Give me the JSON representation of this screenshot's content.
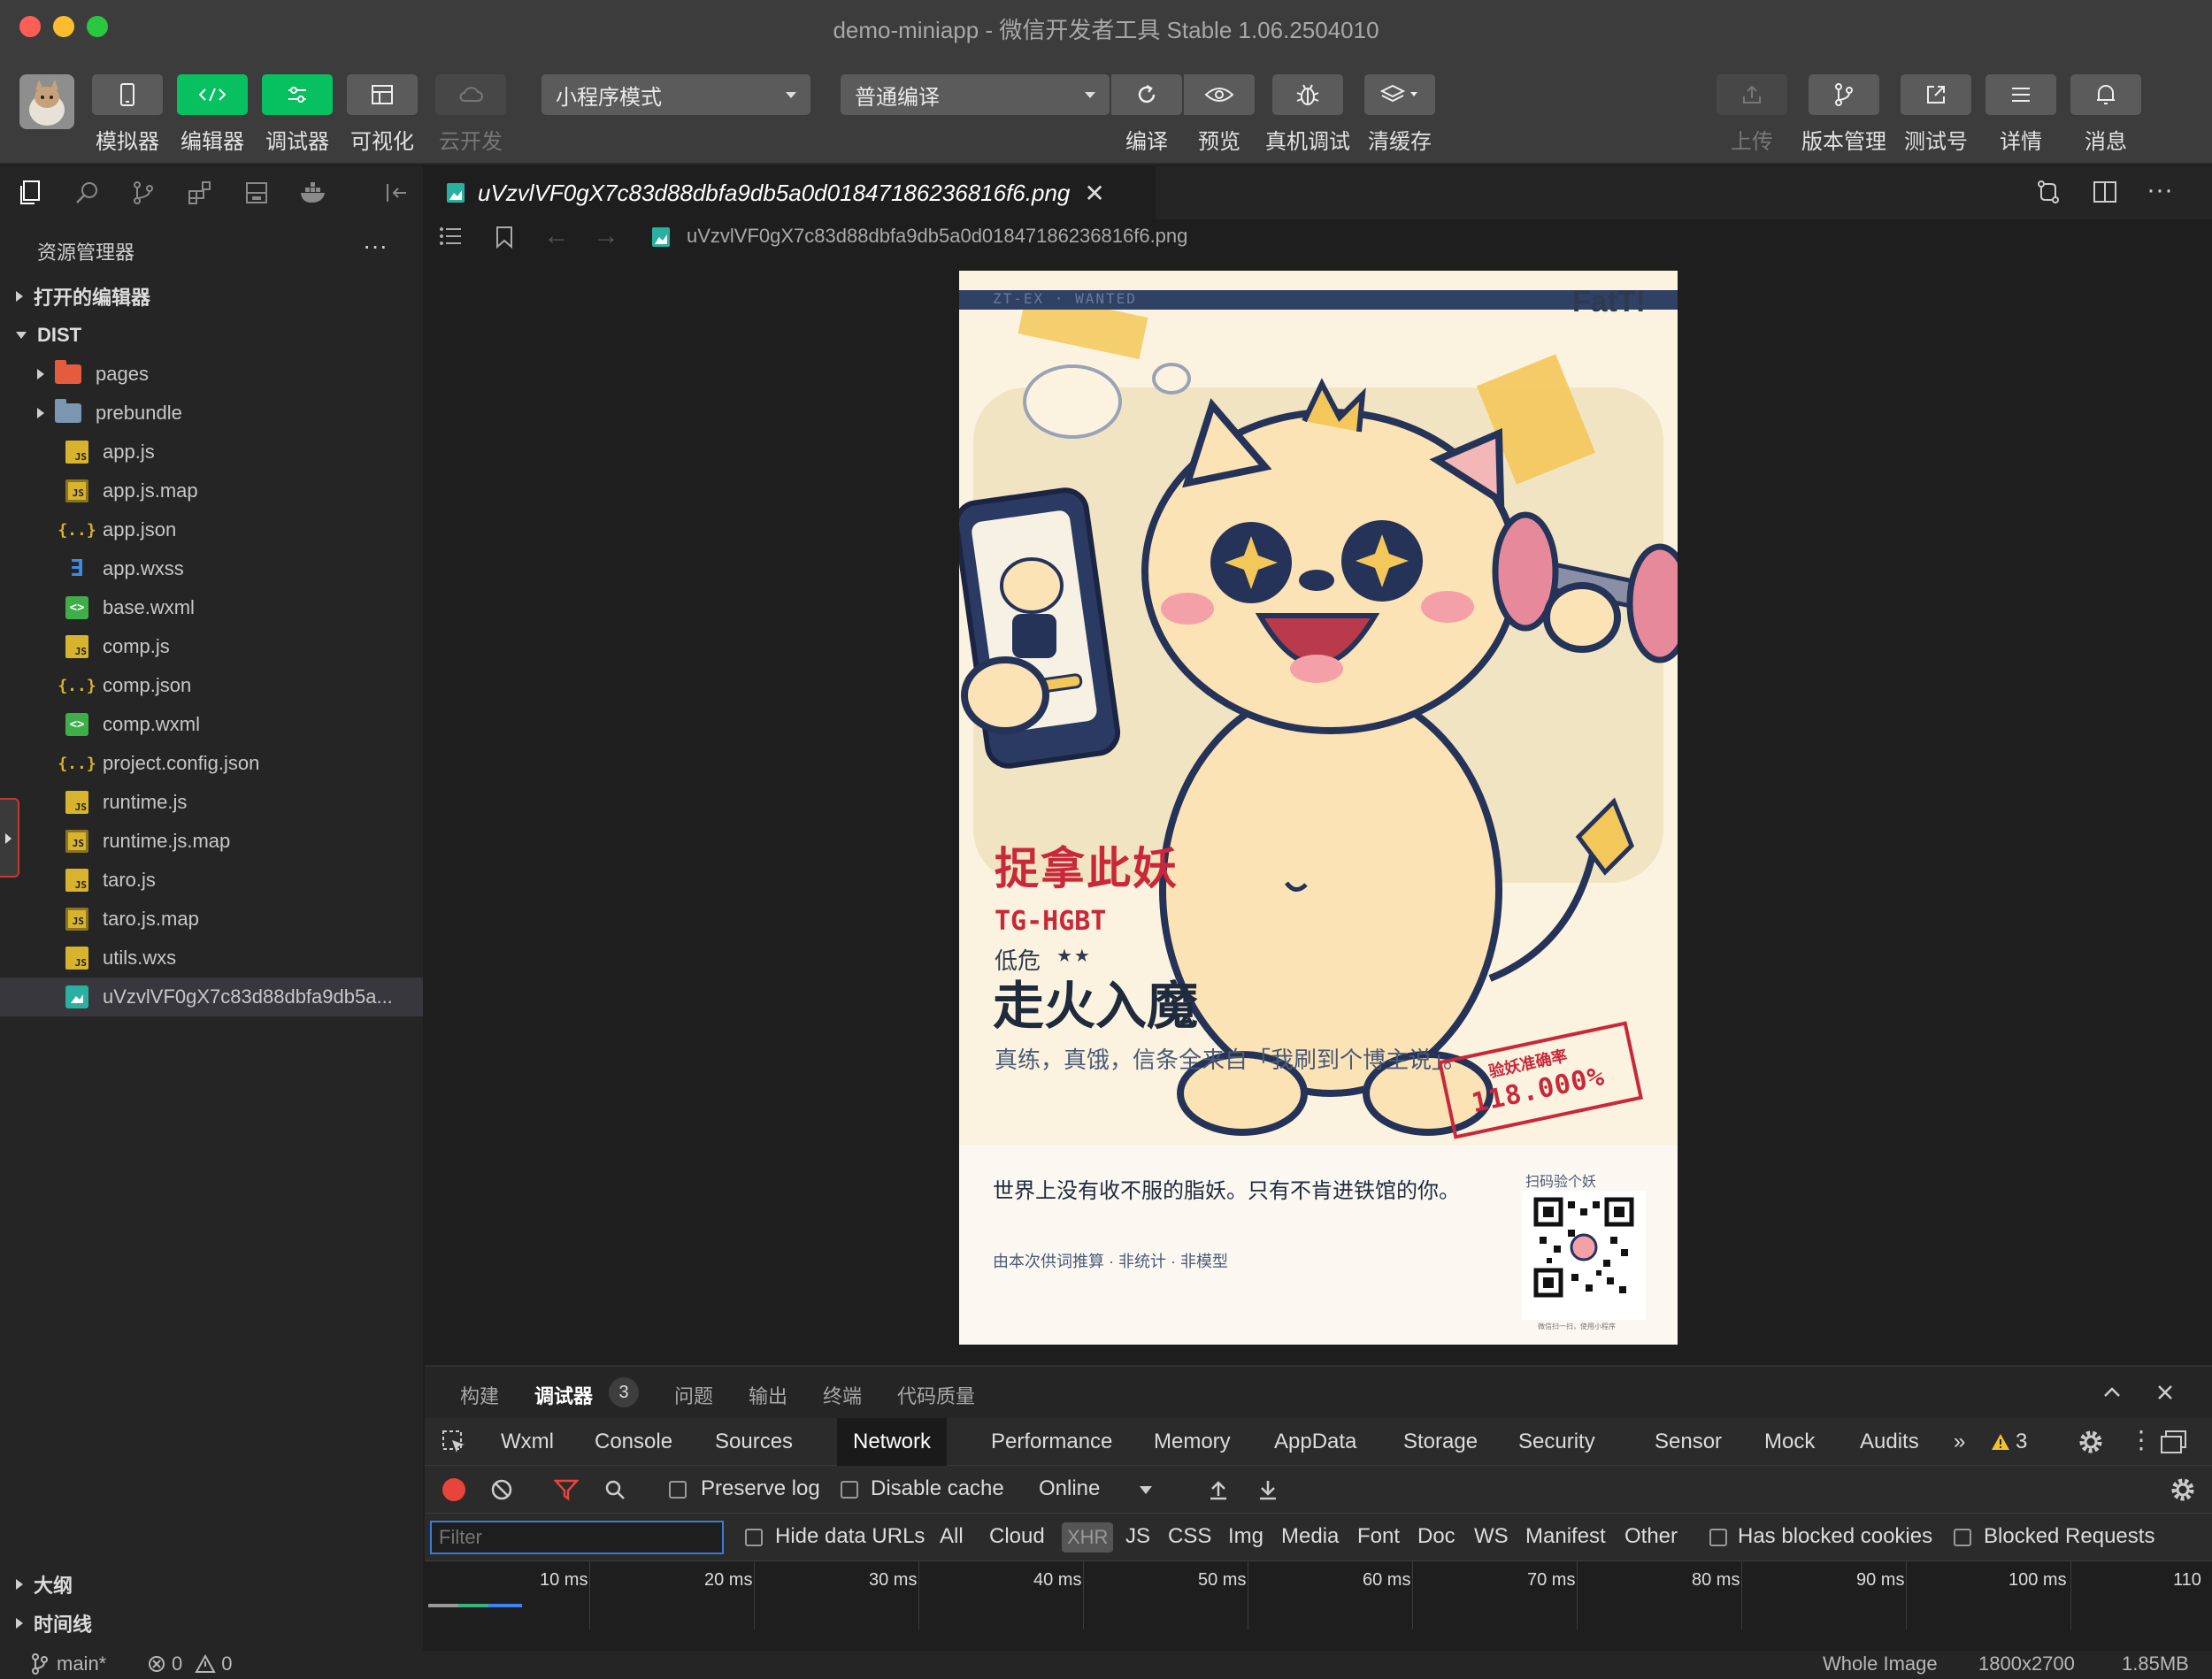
{
  "window": {
    "title": "demo-miniapp",
    "subtitle": "微信开发者工具 Stable 1.06.2504010",
    "traffic_colors": [
      "#ff5f57",
      "#febc2e",
      "#28c840"
    ]
  },
  "toolbar": {
    "left_buttons": [
      {
        "label": "模拟器",
        "icon": "phone-icon"
      },
      {
        "label": "编辑器",
        "icon": "code-icon"
      },
      {
        "label": "调试器",
        "icon": "sliders-icon"
      },
      {
        "label": "可视化",
        "icon": "layout-icon"
      },
      {
        "label": "云开发",
        "icon": "cloud-icon"
      }
    ],
    "mode_select": "小程序模式",
    "compile_select": "普通编译",
    "center_buttons": [
      {
        "label": "编译",
        "icon": "refresh-icon"
      },
      {
        "label": "预览",
        "icon": "eye-icon"
      },
      {
        "label": "真机调试",
        "icon": "bug-icon"
      },
      {
        "label": "清缓存",
        "icon": "layers-icon"
      }
    ],
    "right_buttons": [
      {
        "label": "上传",
        "icon": "upload-icon"
      },
      {
        "label": "版本管理",
        "icon": "branch-icon"
      },
      {
        "label": "测试号",
        "icon": "external-link-icon"
      },
      {
        "label": "详情",
        "icon": "menu-icon"
      },
      {
        "label": "消息",
        "icon": "bell-icon"
      }
    ],
    "accent": "#07c160"
  },
  "sidebar": {
    "title": "资源管理器",
    "more": "···",
    "sections": {
      "open_editors": "打开的编辑器",
      "dist": "DIST",
      "outline": "大纲",
      "timeline": "时间线"
    },
    "items": [
      {
        "name": "pages",
        "type": "folder-pages"
      },
      {
        "name": "prebundle",
        "type": "folder"
      },
      {
        "name": "app.js",
        "type": "js"
      },
      {
        "name": "app.js.map",
        "type": "jsmap"
      },
      {
        "name": "app.json",
        "type": "json"
      },
      {
        "name": "app.wxss",
        "type": "wxss"
      },
      {
        "name": "base.wxml",
        "type": "wxml"
      },
      {
        "name": "comp.js",
        "type": "js"
      },
      {
        "name": "comp.json",
        "type": "json"
      },
      {
        "name": "comp.wxml",
        "type": "wxml"
      },
      {
        "name": "project.config.json",
        "type": "json"
      },
      {
        "name": "runtime.js",
        "type": "js"
      },
      {
        "name": "runtime.js.map",
        "type": "jsmap"
      },
      {
        "name": "taro.js",
        "type": "js"
      },
      {
        "name": "taro.js.map",
        "type": "jsmap"
      },
      {
        "name": "utils.wxs",
        "type": "js"
      },
      {
        "name": "uVzvlVF0gX7c83d88dbfa9db5a...",
        "type": "png",
        "selected": true
      }
    ]
  },
  "editor": {
    "tab_name": "uVzvlVF0gX7c83d88dbfa9db5a0d01847186236816f6.png",
    "breadcrumb": "uVzvlVF0gX7c83d88dbfa9db5a0d01847186236816f6.png"
  },
  "poster": {
    "header_left": "ZT-EX · WANTED",
    "brand": "FatT!",
    "title_red": "捉拿此妖",
    "code": "TG-HGBT",
    "level": "低危",
    "stars": "★★",
    "main": "走火入魔",
    "sub": "真练，真饿，信条全来自「我刷到个博主说」。",
    "stamp_label": "验妖准确率",
    "stamp_value": "118.000%",
    "slogan": "世界上没有收不服的脂妖。只有不肯进铁馆的你。",
    "note": "由本次供词推算 · 非统计 · 非模型",
    "qr_label": "扫码验个妖",
    "qr_caption": "微信扫一扫，使用小程序"
  },
  "panel": {
    "tabs": [
      "构建",
      "调试器",
      "问题",
      "输出",
      "终端",
      "代码质量"
    ],
    "active_tab": "调试器",
    "debugger_badge": "3"
  },
  "devtools": {
    "tabs": [
      "Wxml",
      "Console",
      "Sources",
      "Network",
      "Performance",
      "Memory",
      "AppData",
      "Storage",
      "Security",
      "Sensor",
      "Mock",
      "Audits"
    ],
    "active_tab": "Network",
    "overflow": "»",
    "warning_count": "3",
    "preserve_log": "Preserve log",
    "disable_cache": "Disable cache",
    "throttle": "Online",
    "filter_placeholder": "Filter",
    "hide_data_urls": "Hide data URLs",
    "types": [
      "All",
      "Cloud",
      "XHR",
      "JS",
      "CSS",
      "Img",
      "Media",
      "Font",
      "Doc",
      "WS",
      "Manifest",
      "Other"
    ],
    "has_blocked_cookies": "Has blocked cookies",
    "blocked_requests": "Blocked Requests",
    "ticks": [
      "10 ms",
      "20 ms",
      "30 ms",
      "40 ms",
      "50 ms",
      "60 ms",
      "70 ms",
      "80 ms",
      "90 ms",
      "100 ms",
      "110"
    ]
  },
  "statusbar": {
    "branch": "main*",
    "errors": "0",
    "warnings": "0",
    "image_mode": "Whole Image",
    "dimensions": "1800x2700",
    "size": "1.85MB"
  }
}
